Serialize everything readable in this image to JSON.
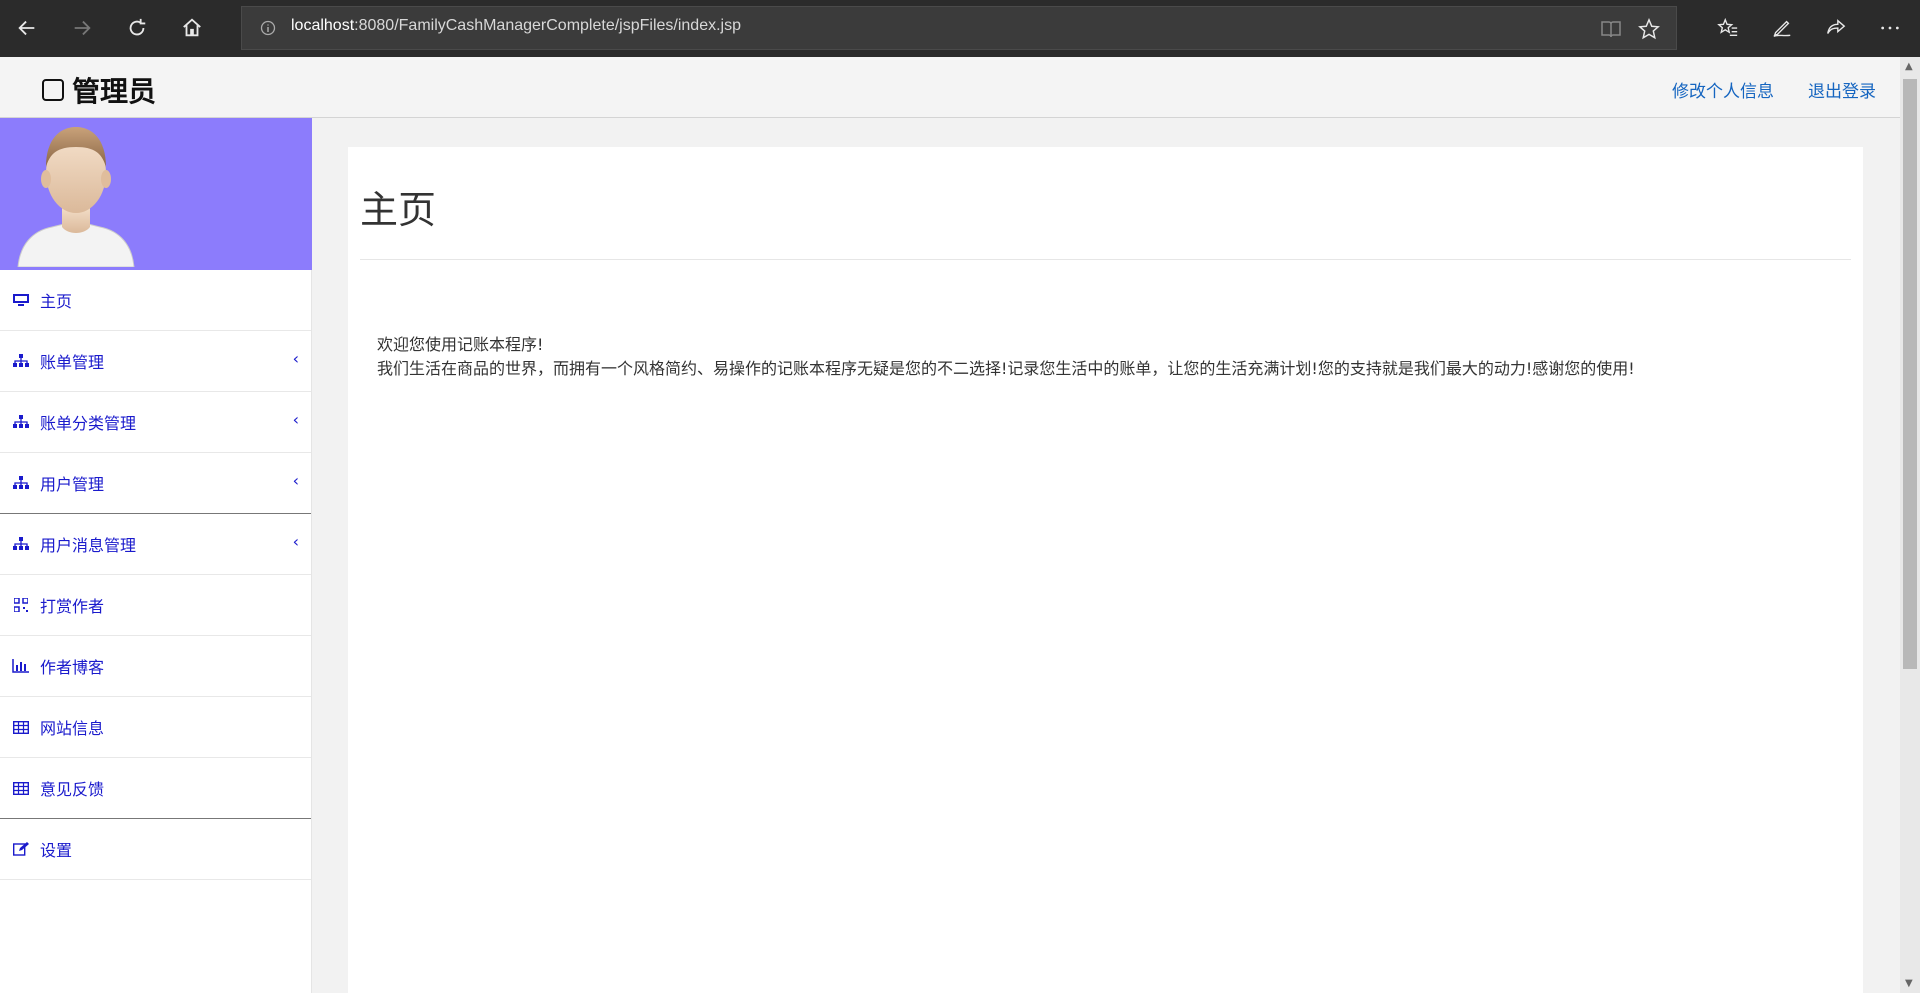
{
  "browser": {
    "url_host": "localhost",
    "url_rest": ":8080/FamilyCashManagerComplete/jspFiles/index.jsp"
  },
  "header": {
    "brand": "管理员",
    "edit_profile": "修改个人信息",
    "logout": "退出登录"
  },
  "sidebar": {
    "items": [
      {
        "label": "主页",
        "icon": "monitor-icon"
      },
      {
        "label": "账单管理",
        "icon": "sitemap-icon",
        "chevron": "‹"
      },
      {
        "label": "账单分类管理",
        "icon": "sitemap-icon",
        "chevron": "‹"
      },
      {
        "label": "用户管理",
        "icon": "sitemap-icon",
        "chevron": "‹"
      },
      {
        "label": "用户消息管理",
        "icon": "sitemap-icon",
        "chevron": "‹"
      },
      {
        "label": "打赏作者",
        "icon": "qrcode-icon"
      },
      {
        "label": "作者博客",
        "icon": "bar-chart-icon"
      },
      {
        "label": "网站信息",
        "icon": "table-icon"
      },
      {
        "label": "意见反馈",
        "icon": "table-icon"
      },
      {
        "label": "设置",
        "icon": "edit-icon"
      }
    ]
  },
  "main": {
    "title": "主页",
    "welcome_line1": "欢迎您使用记账本程序!",
    "welcome_line2": "我们生活在商品的世界，而拥有一个风格简约、易操作的记账本程序无疑是您的不二选择!记录您生活中的账单，让您的生活充满计划!您的支持就是我们最大的动力!感谢您的使用!"
  },
  "colors": {
    "accent_link": "#1565c0",
    "menu_text": "#1a1acc",
    "avatar_bg": "#8c7cfc"
  }
}
